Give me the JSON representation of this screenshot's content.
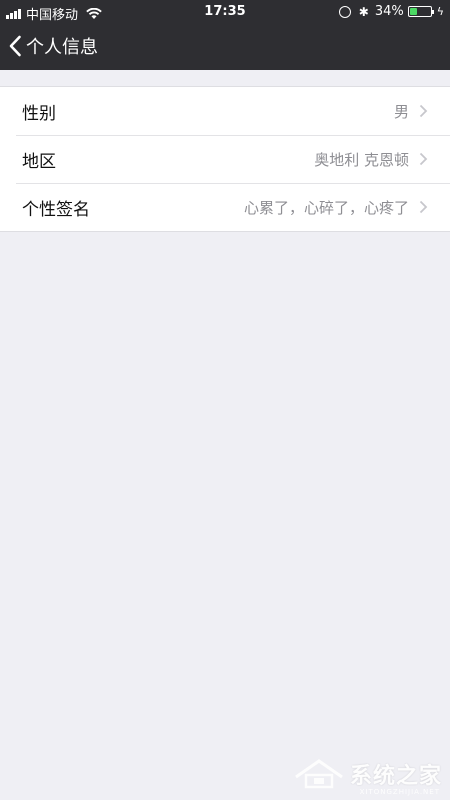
{
  "status_bar": {
    "carrier": "中国移动",
    "time": "17:35",
    "battery_percent": "34%",
    "battery_level": 0.34
  },
  "nav": {
    "title": "个人信息"
  },
  "rows": [
    {
      "label": "性别",
      "value": "男"
    },
    {
      "label": "地区",
      "value": "奥地利 克恩顿"
    },
    {
      "label": "个性签名",
      "value": "心累了，心碎了，心疼了"
    }
  ],
  "watermark": {
    "brand": "系统之家",
    "domain": "XITONGZHIJIA.NET"
  },
  "colors": {
    "topbar": "#2e2e32",
    "background": "#efeff4",
    "battery_fill": "#4cd964",
    "secondary_text": "#8e8e93"
  }
}
